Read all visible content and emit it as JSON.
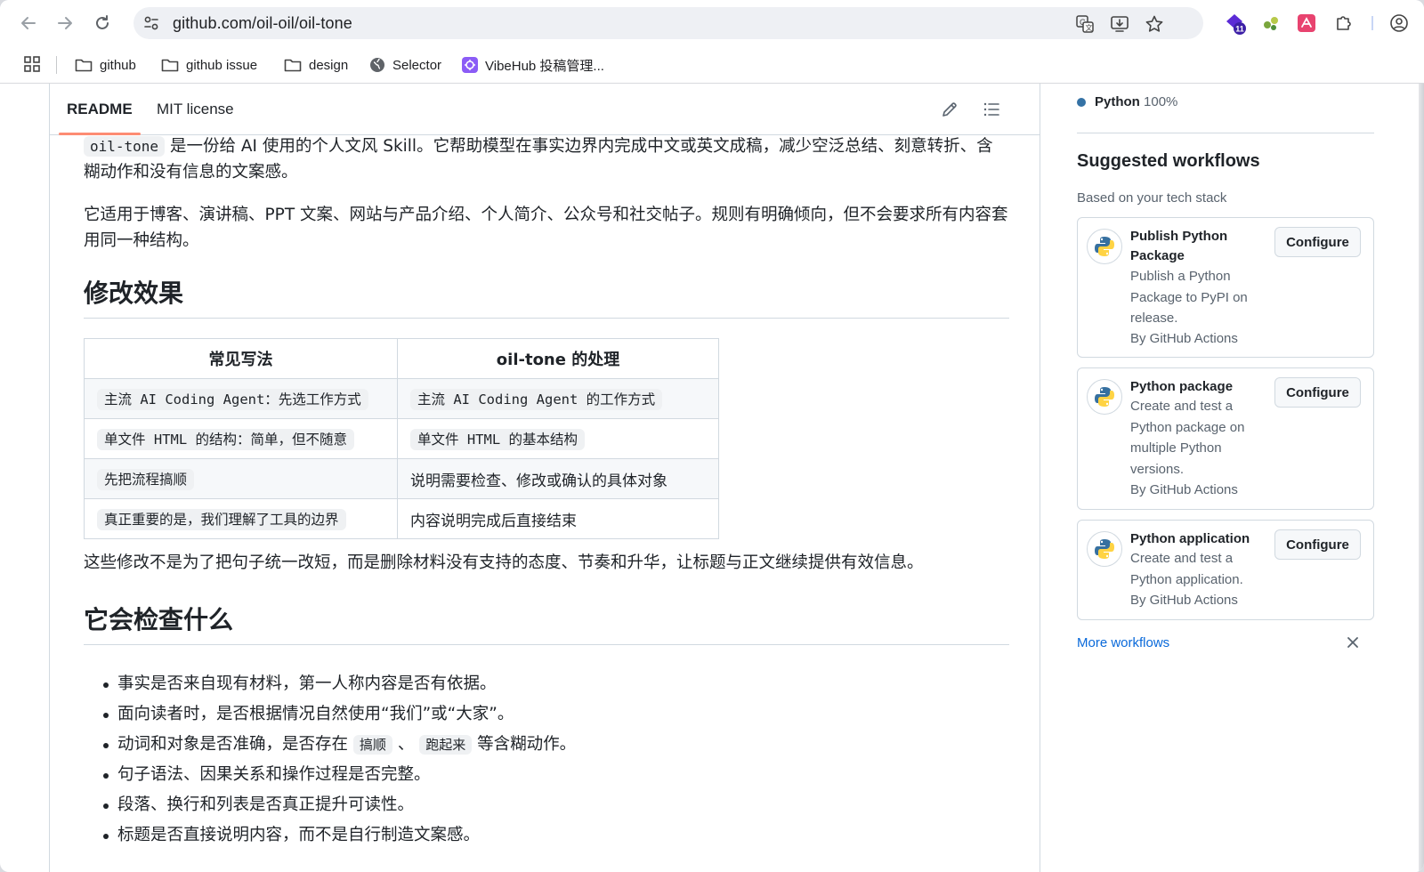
{
  "browser": {
    "url": "github.com/oil-oil/oil-tone",
    "extensions_badge": "11",
    "bookmarks": [
      {
        "label": "github",
        "icon": "folder-icon"
      },
      {
        "label": "github issue",
        "icon": "folder-icon"
      },
      {
        "label": "design",
        "icon": "folder-icon"
      },
      {
        "label": "Selector",
        "icon": "globe-icon"
      },
      {
        "label": "VibeHub 投稿管理...",
        "icon": "vibehub-icon"
      }
    ]
  },
  "readme": {
    "tabs": [
      "README",
      "MIT license"
    ],
    "intro_code": "oil-tone",
    "intro_text": " 是一份给 AI 使用的个人文风 Skill。它帮助模型在事实边界内完成中文或英文成稿，减少空泛总结、刻意转折、含糊动作和没有信息的文案感。",
    "para2": "它适用于博客、演讲稿、PPT 文案、网站与产品介绍、个人简介、公众号和社交帖子。规则有明确倾向，但不会要求所有内容套用同一种结构。",
    "h2_effect": "修改效果",
    "table": {
      "headers": [
        "常见写法",
        "oil-tone 的处理"
      ],
      "rows": [
        {
          "a": "主流 AI Coding Agent：先选工作方式",
          "a_code": true,
          "b": "主流 AI Coding Agent 的工作方式",
          "b_code": true
        },
        {
          "a": "单文件 HTML 的结构：简单，但不随意",
          "a_code": true,
          "b": "单文件 HTML 的基本结构",
          "b_code": true
        },
        {
          "a": "先把流程搞顺",
          "a_code": true,
          "b": "说明需要检查、修改或确认的具体对象",
          "b_code": false
        },
        {
          "a": "真正重要的是，我们理解了工具的边界",
          "a_code": true,
          "b": "内容说明完成后直接结束",
          "b_code": false
        }
      ]
    },
    "para3": "这些修改不是为了把句子统一改短，而是删除材料没有支持的态度、节奏和升华，让标题与正文继续提供有效信息。",
    "h2_checks": "它会检查什么",
    "checks": {
      "item1": "事实是否来自现有材料，第一人称内容是否有依据。",
      "item2": "面向读者时，是否根据情况自然使用“我们”或“大家”。",
      "item3_pre": "动词和对象是否准确，是否存在",
      "item3_code1": "搞顺",
      "item3_sep": "、",
      "item3_code2": "跑起来",
      "item3_post": "等含糊动作。",
      "item4": "句子语法、因果关系和操作过程是否完整。",
      "item5": "段落、换行和列表是否真正提升可读性。",
      "item6": "标题是否直接说明内容，而不是自行制造文案感。"
    }
  },
  "sidebar": {
    "language": {
      "name": "Python",
      "percent": "100%",
      "color": "#3572a5"
    },
    "suggested_title": "Suggested workflows",
    "suggested_sub": "Based on your tech stack",
    "workflows": [
      {
        "name": "Publish Python Package",
        "desc": "Publish a Python Package to PyPI on release.",
        "by": "By GitHub Actions",
        "button": "Configure"
      },
      {
        "name": "Python package",
        "desc": "Create and test a Python package on multiple Python versions.",
        "by": "By GitHub Actions",
        "button": "Configure"
      },
      {
        "name": "Python application",
        "desc": "Create and test a Python application.",
        "by": "By GitHub Actions",
        "button": "Configure"
      }
    ],
    "more_workflows": "More workflows"
  }
}
